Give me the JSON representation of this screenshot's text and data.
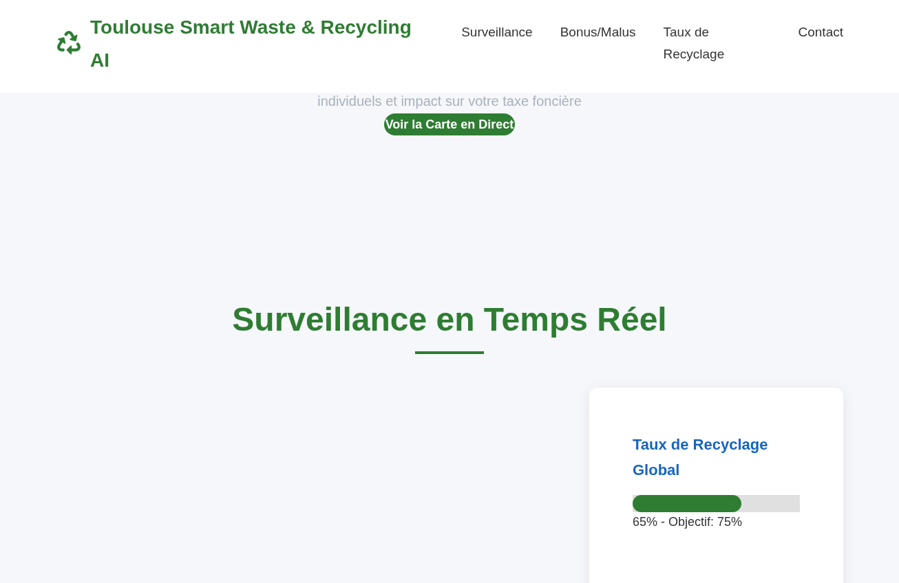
{
  "header": {
    "logo_title": "Toulouse Smart Waste & Recycling AI",
    "nav": [
      "Surveillance",
      "Bonus/Malus",
      "Taux de Recyclage",
      "Contact"
    ]
  },
  "hero": {
    "subtitle": "individuels et impact sur votre taxe foncière",
    "button": "Voir la Carte en Direct"
  },
  "section": {
    "title": "Surveillance en Temps Réel",
    "cards": [
      {
        "title": "Taux de Recyclage Global",
        "level": 0.65,
        "reading": "65% - Objectif: 75%"
      }
    ]
  }
}
